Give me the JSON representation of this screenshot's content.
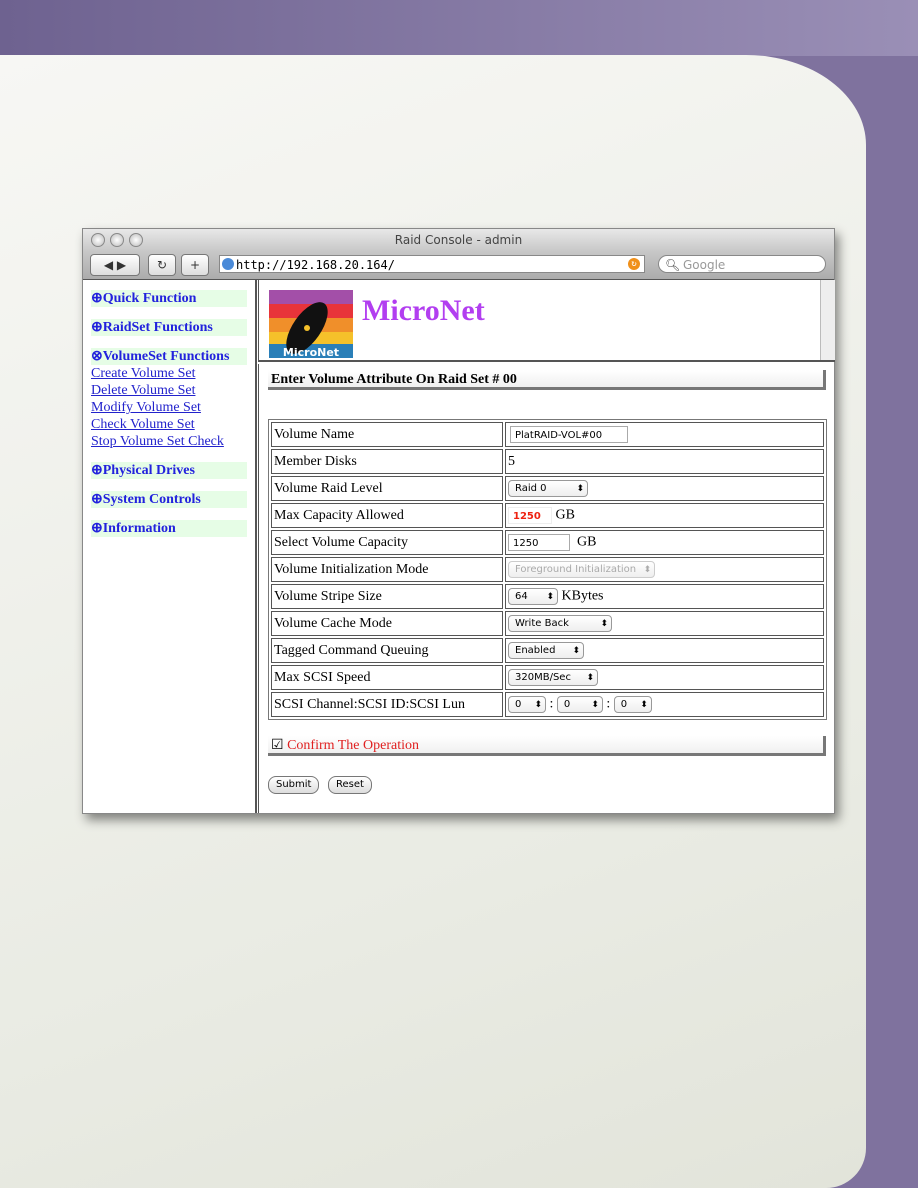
{
  "window": {
    "title": "Raid Console - admin",
    "url": "http://192.168.20.164/",
    "search_placeholder": "Google"
  },
  "sidebar": {
    "sections": [
      {
        "label": "⊕Quick Function"
      },
      {
        "label": "⊕RaidSet Functions"
      },
      {
        "label": "⊗VolumeSet Functions",
        "links": [
          "Create Volume Set",
          "Delete Volume Set",
          "Modify Volume Set",
          "Check Volume Set",
          "Stop Volume Set Check"
        ]
      },
      {
        "label": "⊕Physical Drives"
      },
      {
        "label": "⊕System Controls"
      },
      {
        "label": "⊕Information"
      }
    ]
  },
  "header": {
    "brand": "MicroNet",
    "logo_text": "MicroNet",
    "brand_color": "#b23ef0"
  },
  "form": {
    "title": "Enter Volume Attribute On Raid Set # 00",
    "rows": [
      {
        "label": "Volume Name",
        "value": "PlatRAID-VOL#00"
      },
      {
        "label": "Member Disks",
        "value": "5"
      },
      {
        "label": "Volume Raid Level",
        "value": "Raid 0"
      },
      {
        "label": "Max Capacity Allowed",
        "value": "1250",
        "unit": "GB"
      },
      {
        "label": "Select Volume Capacity",
        "value": "1250",
        "unit": "GB"
      },
      {
        "label": "Volume Initialization Mode",
        "value": "Foreground Initialization"
      },
      {
        "label": "Volume Stripe Size",
        "value": "64",
        "unit": "KBytes"
      },
      {
        "label": "Volume Cache Mode",
        "value": "Write Back"
      },
      {
        "label": "Tagged Command Queuing",
        "value": "Enabled"
      },
      {
        "label": "Max SCSI Speed",
        "value": "320MB/Sec"
      },
      {
        "label": "SCSI Channel:SCSI ID:SCSI Lun",
        "values": [
          "0",
          "0",
          "0"
        ],
        "sep": ":"
      }
    ],
    "confirm": {
      "label": "Confirm The Operation",
      "checked": true
    },
    "submit": "Submit",
    "reset": "Reset"
  }
}
